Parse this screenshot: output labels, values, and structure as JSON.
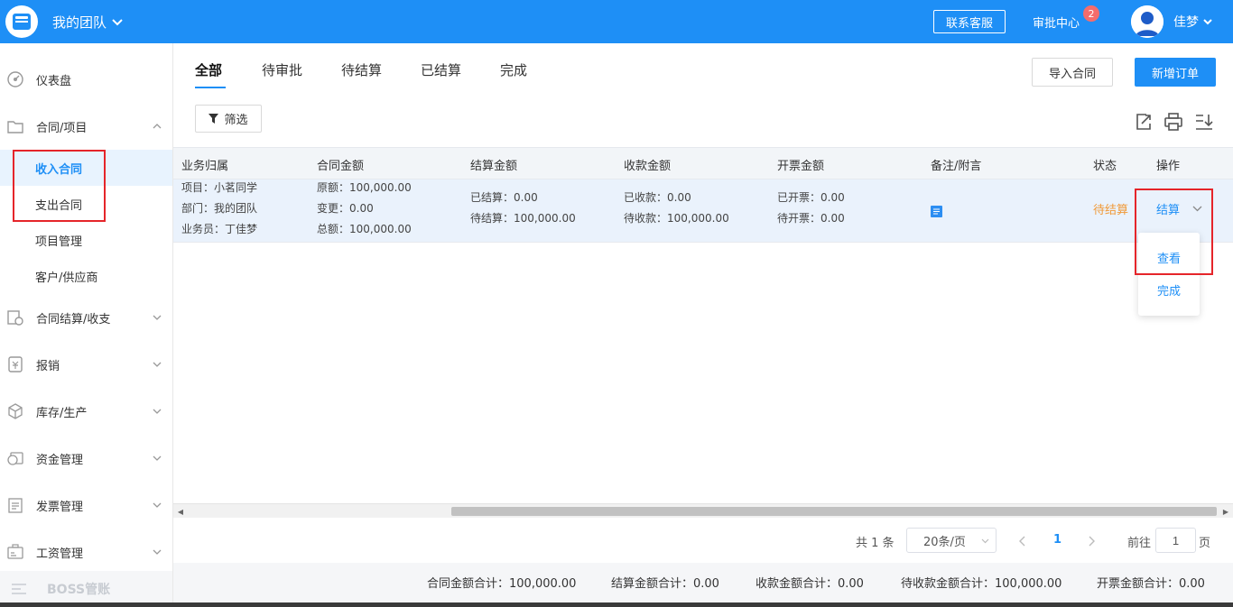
{
  "header": {
    "team_label": "我的团队",
    "contact_button": "联系客服",
    "approval_center": "审批中心",
    "approval_badge": "2",
    "user_name": "佳梦"
  },
  "sidebar": {
    "dashboard": "仪表盘",
    "contract_project": "合同/项目",
    "income_contract": "收入合同",
    "expense_contract": "支出合同",
    "project_mgmt": "项目管理",
    "customer_supplier": "客户/供应商",
    "contract_settlement": "合同结算/收支",
    "reimbursement": "报销",
    "inventory": "库存/生产",
    "funds": "资金管理",
    "invoice": "发票管理",
    "salary": "工资管理",
    "boss": "BOSS管账"
  },
  "tabs": [
    "全部",
    "待审批",
    "待结算",
    "已结算",
    "完成"
  ],
  "actions": {
    "import_contract": "导入合同",
    "new_order": "新增订单",
    "filter": "筛选"
  },
  "table": {
    "headers": [
      "业务归属",
      "合同金额",
      "结算金额",
      "收款金额",
      "开票金额",
      "备注/附言",
      "状态",
      "操作"
    ],
    "row": {
      "project": "项目：小茗同学",
      "dept": "部门：我的团队",
      "salesman": "业务员：丁佳梦",
      "original": "原额：100,000.00",
      "change": "变更：0.00",
      "total": "总额：100,000.00",
      "settled": "已结算：0.00",
      "to_settle": "待结算：100,000.00",
      "received": "已收款：0.00",
      "to_receive": "待收款：100,000.00",
      "invoiced": "已开票：0.00",
      "to_invoice": "待开票：0.00",
      "status": "待结算",
      "action": "结算"
    },
    "dropdown": [
      "查看",
      "完成"
    ]
  },
  "pagination": {
    "total": "共 1 条",
    "page_size": "20条/页",
    "current_page": "1",
    "goto": "前往",
    "goto_value": "1",
    "page_unit": "页"
  },
  "footer": {
    "contract_total": "合同金额合计：100,000.00",
    "settle_total": "结算金额合计：0.00",
    "receive_total": "收款金额合计：0.00",
    "pending_receive_total": "待收款金额合计：100,000.00",
    "invoice_total": "开票金额合计：0.00"
  },
  "colors": {
    "primary": "#1e8ff6",
    "status_pending": "#f09a39",
    "highlight_box": "#e5252a"
  }
}
